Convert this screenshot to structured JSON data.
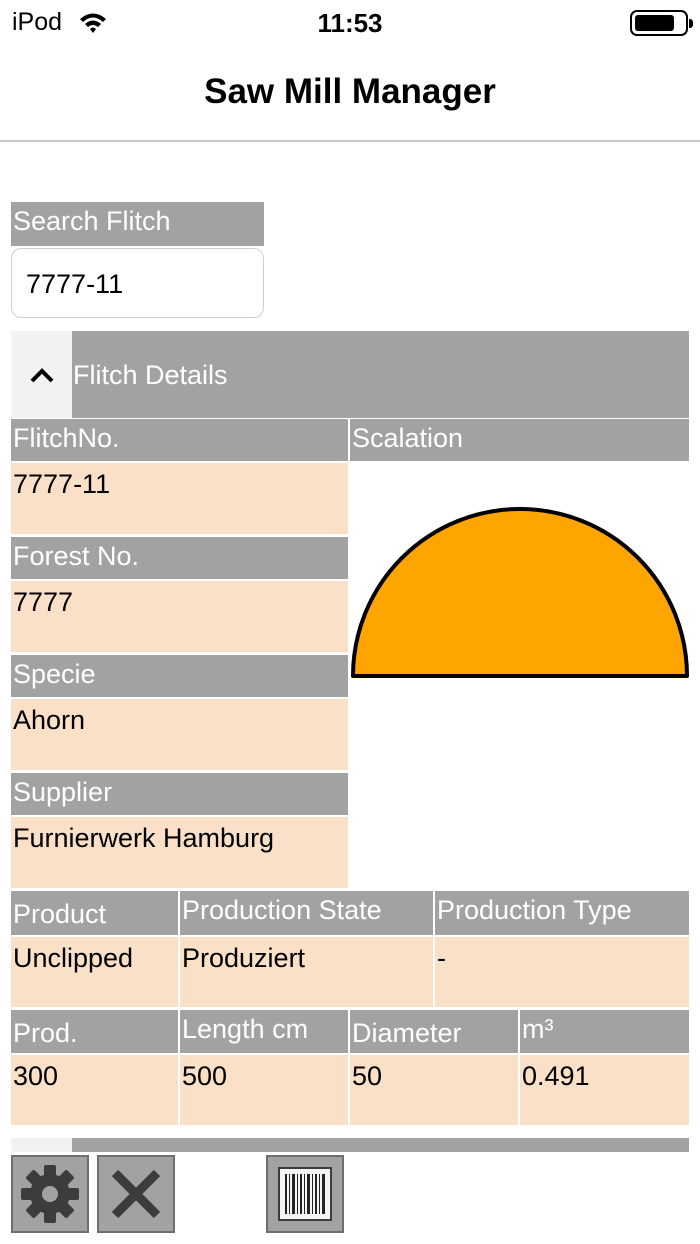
{
  "status_bar": {
    "carrier": "iPod",
    "time": "11:53",
    "wifi_icon": "wifi-icon",
    "battery_icon": "battery-icon"
  },
  "nav": {
    "title": "Saw Mill Manager"
  },
  "search": {
    "label": "Search Flitch",
    "value": "7777-11"
  },
  "details": {
    "title": "Flitch Details",
    "collapse_icon": "chevron-up-icon",
    "flitch_no_label": "FlitchNo.",
    "flitch_no": "7777-11",
    "forest_no_label": "Forest No.",
    "forest_no": "7777",
    "specie_label": "Specie",
    "specie": "Ahorn",
    "supplier_label": "Supplier",
    "supplier": "Furnierwerk Hamburg",
    "scalation_label": "Scalation",
    "scalation_shape": "half-circle",
    "scalation_fill": "#ffa500"
  },
  "production": {
    "product_label": "Product",
    "product": "Unclipped",
    "state_label": "Production State",
    "state": "Produziert",
    "type_label": "Production Type",
    "type": "-"
  },
  "measures": {
    "prod_label": "Prod.",
    "prod": "300",
    "length_label": "Length cm",
    "length": "500",
    "diameter_label": "Diameter",
    "diameter": "50",
    "volume_label": "m³",
    "volume": "0.491"
  },
  "toolbar": {
    "settings_icon": "gear-icon",
    "clear_icon": "close-icon",
    "scan_icon": "barcode-icon"
  },
  "colors": {
    "label_bg": "#a2a2a2",
    "value_bg": "#fbe0c8",
    "shape_fill": "#ffa500"
  }
}
